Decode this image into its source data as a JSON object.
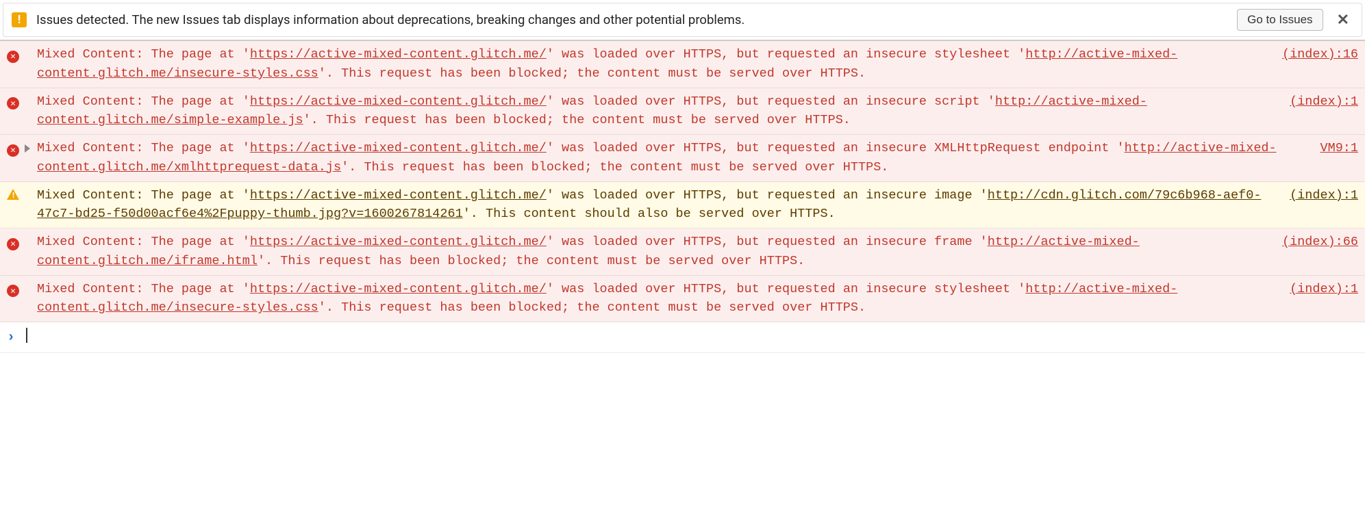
{
  "issues_bar": {
    "message": "Issues detected. The new Issues tab displays information about deprecations, breaking changes and other potential problems.",
    "button_label": "Go to Issues",
    "close_label": "✕"
  },
  "messages": [
    {
      "level": "error",
      "expandable": false,
      "source": "(index):16",
      "parts": [
        {
          "t": "Mixed Content: The page at '"
        },
        {
          "t": "https://active-mixed-content.glitch.me/",
          "u": true
        },
        {
          "t": "' was loaded over HTTPS, but requested an insecure stylesheet '"
        },
        {
          "t": "http://active-mixed-content.glitch.me/insecure-styles.css",
          "u": true
        },
        {
          "t": "'. This request has been blocked; the content must be served over HTTPS."
        }
      ]
    },
    {
      "level": "error",
      "expandable": false,
      "source": "(index):1",
      "parts": [
        {
          "t": "Mixed Content: The page at '"
        },
        {
          "t": "https://active-mixed-content.glitch.me/",
          "u": true
        },
        {
          "t": "' was loaded over HTTPS, but requested an insecure script '"
        },
        {
          "t": "http://active-mixed-content.glitch.me/simple-example.js",
          "u": true
        },
        {
          "t": "'. This request has been blocked; the content must be served over HTTPS."
        }
      ]
    },
    {
      "level": "error",
      "expandable": true,
      "source": "VM9:1",
      "parts": [
        {
          "t": "Mixed Content: The page at '"
        },
        {
          "t": "https://active-mixed-content.glitch.me/",
          "u": true
        },
        {
          "t": "' was loaded over HTTPS, but requested an insecure XMLHttpRequest endpoint '"
        },
        {
          "t": "http://active-mixed-content.glitch.me/xmlhttprequest-data.js",
          "u": true
        },
        {
          "t": "'. This request has been blocked; the content must be served over HTTPS."
        }
      ]
    },
    {
      "level": "warn",
      "expandable": false,
      "source": "(index):1",
      "parts": [
        {
          "t": "Mixed Content: The page at '"
        },
        {
          "t": "https://active-mixed-content.glitch.me/",
          "u": true
        },
        {
          "t": "' was loaded over HTTPS, but requested an insecure image '"
        },
        {
          "t": "http://cdn.glitch.com/79c6b968-aef0-47c7-bd25-f50d00acf6e4%2Fpuppy-thumb.jpg?v=1600267814261",
          "u": true
        },
        {
          "t": "'. This content should also be served over HTTPS."
        }
      ]
    },
    {
      "level": "error",
      "expandable": false,
      "source": "(index):66",
      "parts": [
        {
          "t": "Mixed Content: The page at '"
        },
        {
          "t": "https://active-mixed-content.glitch.me/",
          "u": true
        },
        {
          "t": "' was loaded over HTTPS, but requested an insecure frame '"
        },
        {
          "t": "http://active-mixed-content.glitch.me/iframe.html",
          "u": true
        },
        {
          "t": "'. This request has been blocked; the content must be served over HTTPS."
        }
      ]
    },
    {
      "level": "error",
      "expandable": false,
      "source": "(index):1",
      "parts": [
        {
          "t": "Mixed Content: The page at '"
        },
        {
          "t": "https://active-mixed-content.glitch.me/",
          "u": true
        },
        {
          "t": "' was loaded over HTTPS, but requested an insecure stylesheet '"
        },
        {
          "t": "http://active-mixed-content.glitch.me/insecure-styles.css",
          "u": true
        },
        {
          "t": "'. This request has been blocked; the content must be served over HTTPS."
        }
      ]
    }
  ],
  "prompt_symbol": "›"
}
